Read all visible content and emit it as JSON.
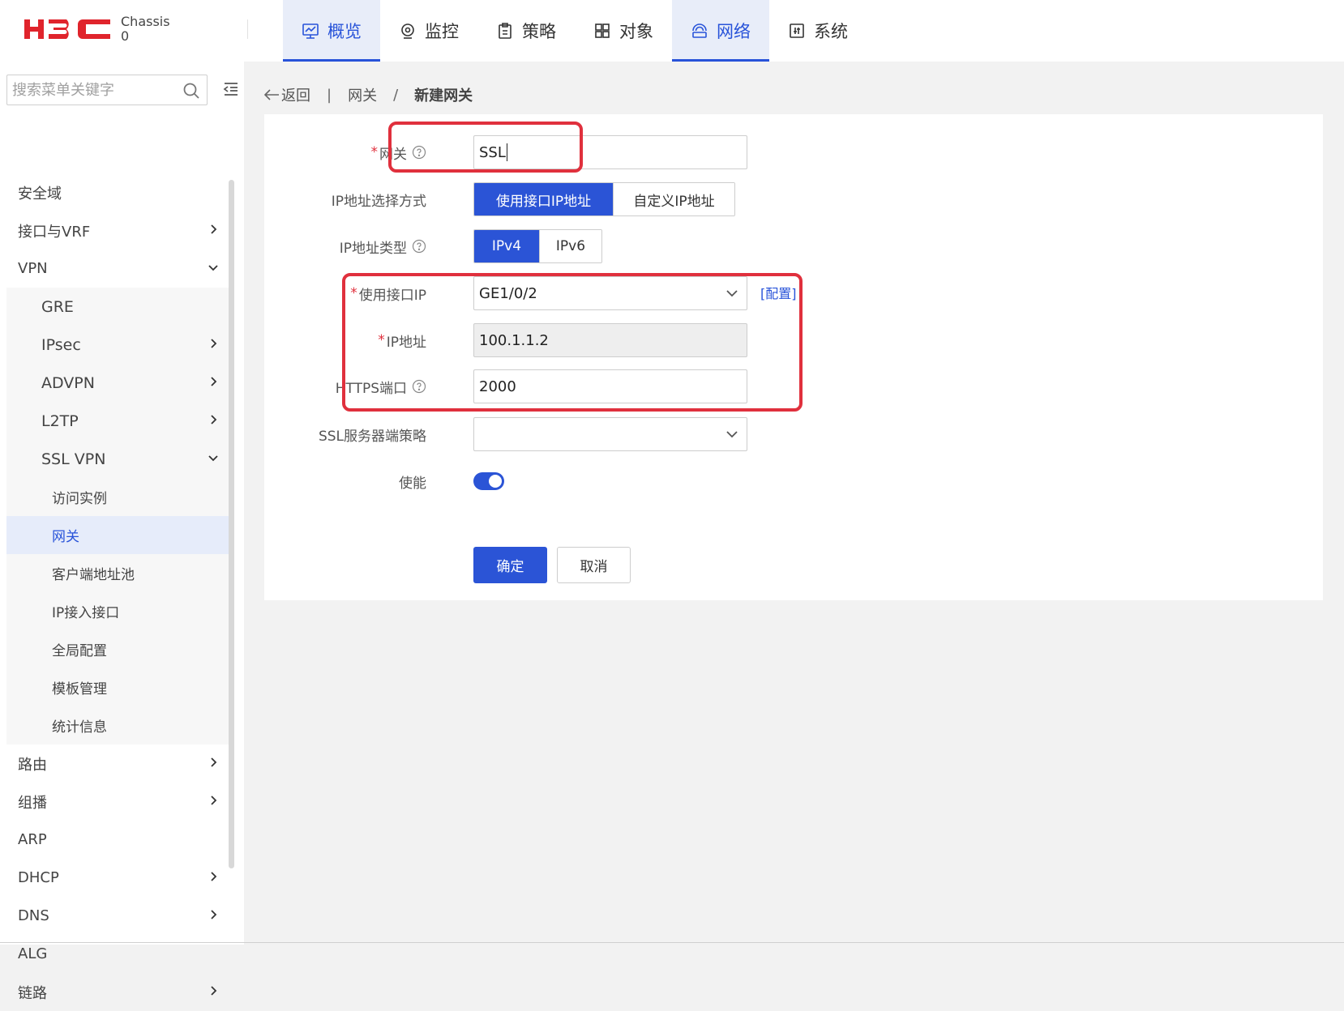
{
  "header": {
    "brand": "H3C",
    "chassis_line1": "Chassis",
    "chassis_line2": "0",
    "nav": [
      {
        "label": "概览",
        "icon": "dashboard-icon",
        "active": true
      },
      {
        "label": "监控",
        "icon": "monitor-icon",
        "active": false
      },
      {
        "label": "策略",
        "icon": "policy-icon",
        "active": false
      },
      {
        "label": "对象",
        "icon": "objects-icon",
        "active": false
      },
      {
        "label": "网络",
        "icon": "network-icon",
        "active": true
      },
      {
        "label": "系统",
        "icon": "system-icon",
        "active": false
      }
    ],
    "accent_color": "#2853d9"
  },
  "sidebar": {
    "search_placeholder": "搜索菜单关键字",
    "items": [
      {
        "label": "安全域",
        "level": 1,
        "arrow": "none"
      },
      {
        "label": "接口与VRF",
        "level": 1,
        "arrow": "right"
      },
      {
        "label": "VPN",
        "level": 1,
        "arrow": "down"
      },
      {
        "label": "GRE",
        "level": 2,
        "arrow": "none"
      },
      {
        "label": "IPsec",
        "level": 2,
        "arrow": "right"
      },
      {
        "label": "ADVPN",
        "level": 2,
        "arrow": "right"
      },
      {
        "label": "L2TP",
        "level": 2,
        "arrow": "right"
      },
      {
        "label": "SSL VPN",
        "level": 2,
        "arrow": "down"
      },
      {
        "label": "访问实例",
        "level": 3,
        "arrow": "none"
      },
      {
        "label": "网关",
        "level": 3,
        "arrow": "none",
        "selected": true
      },
      {
        "label": "客户端地址池",
        "level": 3,
        "arrow": "none"
      },
      {
        "label": "IP接入接口",
        "level": 3,
        "arrow": "none"
      },
      {
        "label": "全局配置",
        "level": 3,
        "arrow": "none"
      },
      {
        "label": "模板管理",
        "level": 3,
        "arrow": "none"
      },
      {
        "label": "统计信息",
        "level": 3,
        "arrow": "none"
      },
      {
        "label": "路由",
        "level": 1,
        "arrow": "right"
      },
      {
        "label": "组播",
        "level": 1,
        "arrow": "right"
      },
      {
        "label": "ARP",
        "level": 1,
        "arrow": "none"
      },
      {
        "label": "DHCP",
        "level": 1,
        "arrow": "right"
      },
      {
        "label": "DNS",
        "level": 1,
        "arrow": "right"
      },
      {
        "label": "ALG",
        "level": 1,
        "arrow": "none"
      },
      {
        "label": "链路",
        "level": 1,
        "arrow": "right"
      }
    ]
  },
  "breadcrumb": {
    "back": "返回",
    "sep": "|",
    "parent": "网关",
    "slash": "/",
    "current": "新建网关"
  },
  "form": {
    "gateway_label": "网关",
    "gateway_value": "SSL",
    "ip_select_label": "IP地址选择方式",
    "ip_select_options": [
      "使用接口IP地址",
      "自定义IP地址"
    ],
    "ip_type_label": "IP地址类型",
    "ip_type_options": [
      "IPv4",
      "IPv6"
    ],
    "use_if_ip_label": "使用接口IP",
    "use_if_ip_value": "GE1/0/2",
    "config_link": "[配置]",
    "ip_addr_label": "IP地址",
    "ip_addr_value": "100.1.1.2",
    "https_port_label": "HTTPS端口",
    "https_port_value": "2000",
    "ssl_policy_label": "SSL服务器端策略",
    "ssl_policy_value": "",
    "enable_label": "使能",
    "enable_on": true,
    "ok_label": "确定",
    "cancel_label": "取消"
  }
}
